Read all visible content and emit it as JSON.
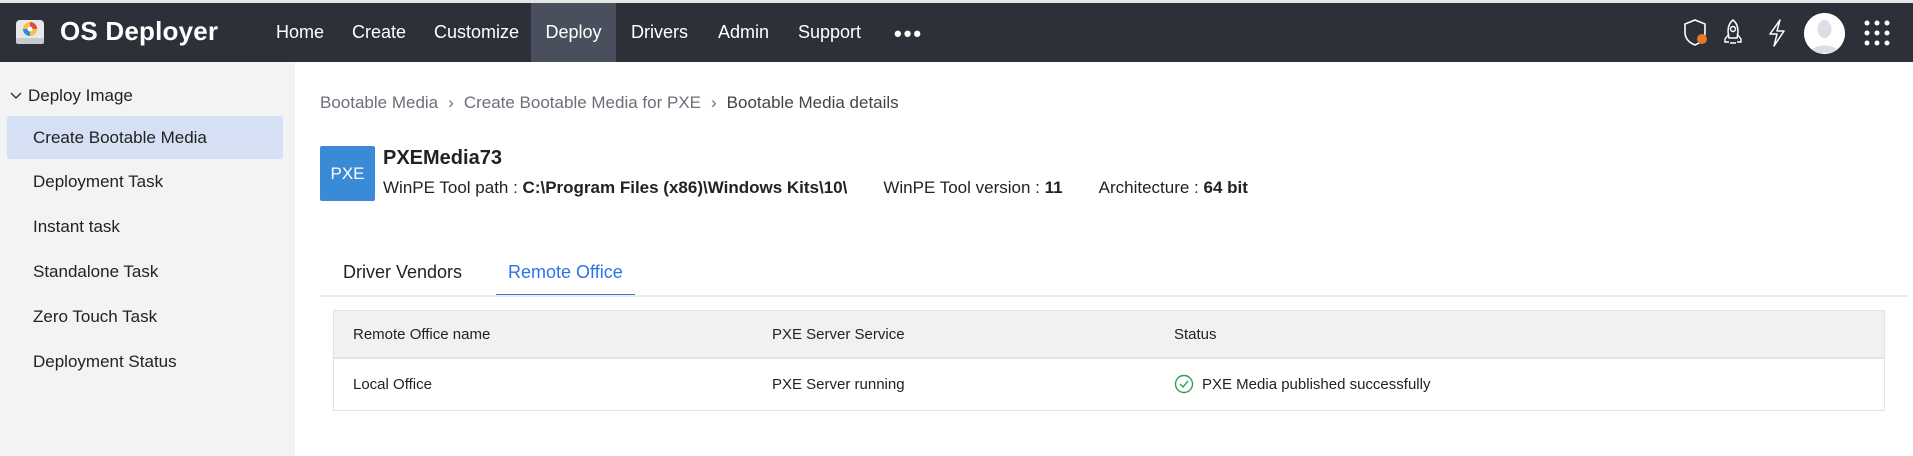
{
  "app": {
    "title": "OS Deployer"
  },
  "nav": [
    {
      "label": "Home"
    },
    {
      "label": "Create"
    },
    {
      "label": "Customize"
    },
    {
      "label": "Deploy",
      "active": true
    },
    {
      "label": "Drivers"
    },
    {
      "label": "Admin"
    },
    {
      "label": "Support"
    }
  ],
  "nav_more": "•••",
  "header_icons": [
    "shield-alert-icon",
    "rocket-icon",
    "lightning-icon",
    "avatar",
    "apps-grid-icon"
  ],
  "sidebar": {
    "section": "Deploy Image",
    "items": [
      {
        "label": "Create Bootable Media",
        "selected": true
      },
      {
        "label": "Deployment Task"
      },
      {
        "label": "Instant task"
      },
      {
        "label": "Standalone Task"
      },
      {
        "label": "Zero Touch Task"
      },
      {
        "label": "Deployment Status"
      }
    ]
  },
  "breadcrumb": [
    "Bootable Media",
    "Create Bootable Media for PXE",
    "Bootable Media details"
  ],
  "media": {
    "badge": "PXE",
    "name": "PXEMedia73",
    "path_label": "WinPE Tool path : ",
    "path": "C:\\Program Files (x86)\\Windows Kits\\10\\",
    "version_label": "WinPE Tool version : ",
    "version": "11",
    "arch_label": "Architecture : ",
    "arch": "64 bit"
  },
  "tabs": [
    {
      "label": "Driver Vendors"
    },
    {
      "label": "Remote Office",
      "active": true
    }
  ],
  "table": {
    "headers": [
      "Remote Office name",
      "PXE Server Service",
      "Status"
    ],
    "rows": [
      [
        "Local Office",
        "PXE Server running",
        "PXE Media published successfully"
      ]
    ]
  },
  "colors": {
    "header_bg": "#2e3039",
    "accent": "#2c72e8",
    "success": "#2e9e5b",
    "badge": "#3a8bd6",
    "alert": "#e8792b"
  }
}
